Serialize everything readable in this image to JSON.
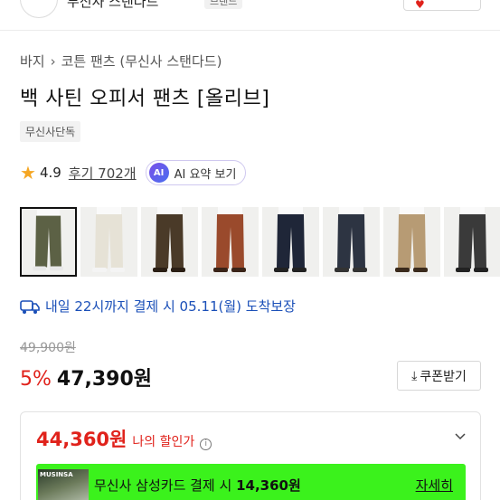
{
  "header": {
    "store_name": "무신사 스탠다드",
    "store_badge": "브랜드"
  },
  "breadcrumb": {
    "category": "바지",
    "subcategory": "코튼 팬츠 (무신사 스탠다드)"
  },
  "product": {
    "title": "백 사틴 오피서 팬츠 [올리브]",
    "exclusive_badge": "무신사단독"
  },
  "rating": {
    "score": "4.9",
    "reviews_label": "후기 702개",
    "ai_icon_text": "AI",
    "ai_summary_label": "AI 요약 보기"
  },
  "thumbnails": [
    {
      "label": "olive",
      "color": "#5c6145",
      "shoe": "#e8e8e8",
      "selected": true
    },
    {
      "label": "ivory",
      "color": "#e6e2d6",
      "shoe": "#f4f4f4",
      "selected": false
    },
    {
      "label": "brown",
      "color": "#4a3a28",
      "shoe": "#2a1e14",
      "selected": false
    },
    {
      "label": "rust",
      "color": "#9a4a2c",
      "shoe": "#3a2418",
      "selected": false
    },
    {
      "label": "navy",
      "color": "#1f2638",
      "shoe": "#222222",
      "selected": false
    },
    {
      "label": "charcoal navy",
      "color": "#2d3442",
      "shoe": "#333333",
      "selected": false
    },
    {
      "label": "beige",
      "color": "#b79b74",
      "shoe": "#3a2a1c",
      "selected": false
    },
    {
      "label": "charcoal",
      "color": "#3a3a3a",
      "shoe": "#222222",
      "selected": false
    }
  ],
  "delivery": {
    "text": "내일 22시까지 결제 시 05.11(월) 도착보장"
  },
  "price": {
    "original": "49,900원",
    "discount_rate": "5%",
    "sale": "47,390원",
    "coupon_button": "쿠폰받기"
  },
  "promo": {
    "my_price": "44,360원",
    "my_price_label": "나의 할인가",
    "card_thumb_text": "MUSINSA",
    "card_text_prefix": "무신사 삼성카드 결제 시",
    "card_price": "14,360원",
    "card_detail": "자세히",
    "banner_color": "#3bf21c",
    "accent_color": "#e0221b"
  }
}
